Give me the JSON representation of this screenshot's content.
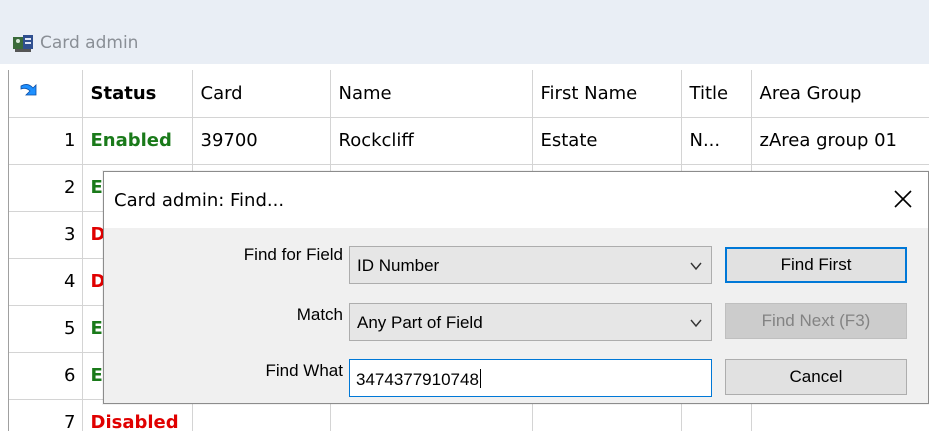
{
  "window": {
    "title": "Card admin",
    "icon": "card-admin-icon"
  },
  "grid": {
    "headers": [
      "Status",
      "Card",
      "Name",
      "First Name",
      "Title",
      "Area Group"
    ],
    "rows": [
      {
        "num": "1",
        "status": "Enabled",
        "card": "39700",
        "name": "Rockcliff",
        "first_name": "Estate",
        "title": "N...",
        "area": "zArea group 01"
      },
      {
        "num": "2",
        "status": "E"
      },
      {
        "num": "3",
        "status": "D"
      },
      {
        "num": "4",
        "status": "D"
      },
      {
        "num": "5",
        "status": "E"
      },
      {
        "num": "6",
        "status": "E"
      },
      {
        "num": "7",
        "status": "Disabled"
      }
    ]
  },
  "dialog": {
    "title": "Card admin: Find...",
    "find_for_field_label": "Find for Field",
    "find_for_field_value": "ID Number",
    "match_label": "Match",
    "match_value": "Any Part of Field",
    "find_what_label": "Find What",
    "find_what_value": "3474377910748",
    "find_first_label": "Find First",
    "find_next_label": "Find Next (F3)",
    "cancel_label": "Cancel"
  },
  "colors": {
    "enabled": "#1a7a1a",
    "disabled": "#e00000",
    "focus": "#0078d7"
  }
}
